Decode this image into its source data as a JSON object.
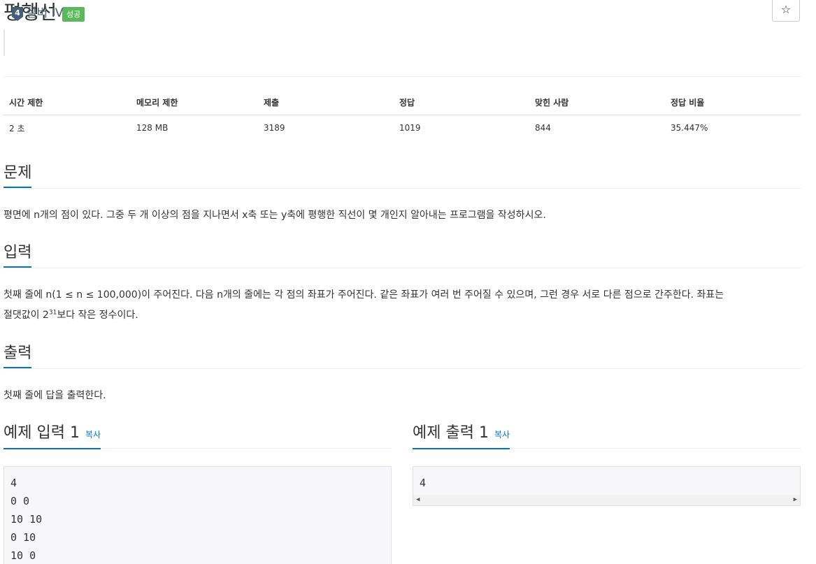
{
  "header": {
    "title": "평행선",
    "badge": "성공",
    "star_icon": "☆"
  },
  "tier": {
    "number": "4",
    "label": "실버 IV",
    "color": "#435f7a"
  },
  "table": {
    "headers": [
      "시간 제한",
      "메모리 제한",
      "제출",
      "정답",
      "맞힌 사람",
      "정답 비율"
    ],
    "values": [
      "2 초",
      "128 MB",
      "3189",
      "1019",
      "844",
      "35.447%"
    ]
  },
  "sections": {
    "problem": {
      "title": "문제",
      "text": "평면에 n개의 점이 있다. 그중 두 개 이상의 점을 지나면서 x축 또는 y축에 평행한 직선이 몇 개인지 알아내는 프로그램을 작성하시오."
    },
    "input": {
      "title": "입력",
      "text_a": "첫째 줄에 n(1 ≤ n ≤ 100,000)이 주어진다. 다음 n개의 줄에는 각 점의 좌표가 주어진다. 같은 좌표가 여러 번 주어질 수 있으며, 그런 경우 서로 다른 점으로 간주한다. 좌표는",
      "text_b": "절댓값이 2",
      "sup": "31",
      "text_c": "보다 작은 정수이다."
    },
    "output": {
      "title": "출력",
      "text": "첫째 줄에 답을 출력한다."
    }
  },
  "samples": {
    "input": {
      "title": "예제 입력 1",
      "copy": "복사",
      "content": "4\n0 0\n10 10\n0 10\n10 0"
    },
    "output": {
      "title": "예제 출력 1",
      "copy": "복사",
      "content": "4"
    }
  },
  "colors": {
    "accent": "#0076c0",
    "success": "#5cb85c"
  }
}
